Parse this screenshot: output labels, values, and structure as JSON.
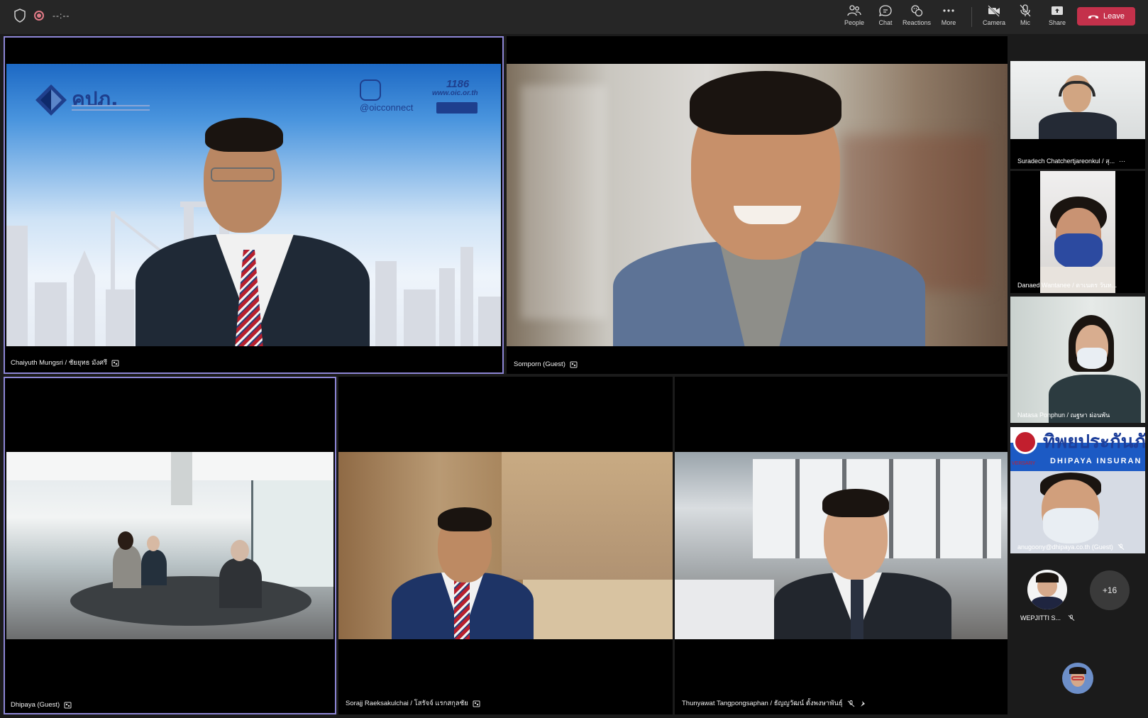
{
  "toolbar": {
    "timer": "--:--",
    "buttons": [
      {
        "label": "People",
        "icon": "people-icon"
      },
      {
        "label": "Chat",
        "icon": "chat-icon"
      },
      {
        "label": "Reactions",
        "icon": "reactions-icon"
      },
      {
        "label": "More",
        "icon": "more-icon"
      },
      {
        "label": "Camera",
        "icon": "camera-off-icon"
      },
      {
        "label": "Mic",
        "icon": "mic-off-icon"
      },
      {
        "label": "Share",
        "icon": "share-icon"
      }
    ],
    "leave_label": "Leave",
    "leave_color": "#c4314b"
  },
  "stage": {
    "tiles": [
      {
        "name": "Chaiyuth Mungsri / ชัยยุทธ มังศรี",
        "background": {
          "logo_text": "คปภ.",
          "brand": "@oicconnect",
          "hotline": "1186",
          "website": "www.oic.or.th"
        }
      },
      {
        "name": "Somporn (Guest)"
      },
      {
        "name": "Dhipaya (Guest)"
      },
      {
        "name": "Sorajj Raeksakulchai / โสรัจจ์ แรกสกุลชัย"
      },
      {
        "name": "Thunyawat Tangpongsaphan / ธัญญวัฒน์ ตั้งพงษาพันธุ์"
      }
    ]
  },
  "gallery": {
    "tiles": [
      {
        "name": "Suradech Chatchertjareonkul / สุ...",
        "more": "···"
      },
      {
        "name": "Danaed Wantanee / ดาเนตร วันท..."
      },
      {
        "name": "Natasa Ponphun / ณฐษา ผ่อนพัน"
      },
      {
        "name": "anugoony@dhipaya.co.th (Guest)",
        "banner": "ทิพยประกันภั",
        "banner_sub": "DHIPAYA INSURAN",
        "banner_side": "VERSARY"
      }
    ],
    "avatar_name": "WEPJITTI S...",
    "overflow_count": "+16"
  },
  "colors": {
    "active_border": "#8d86d6",
    "topbar_bg": "#262626",
    "stage_bg": "#1b1b1b"
  }
}
